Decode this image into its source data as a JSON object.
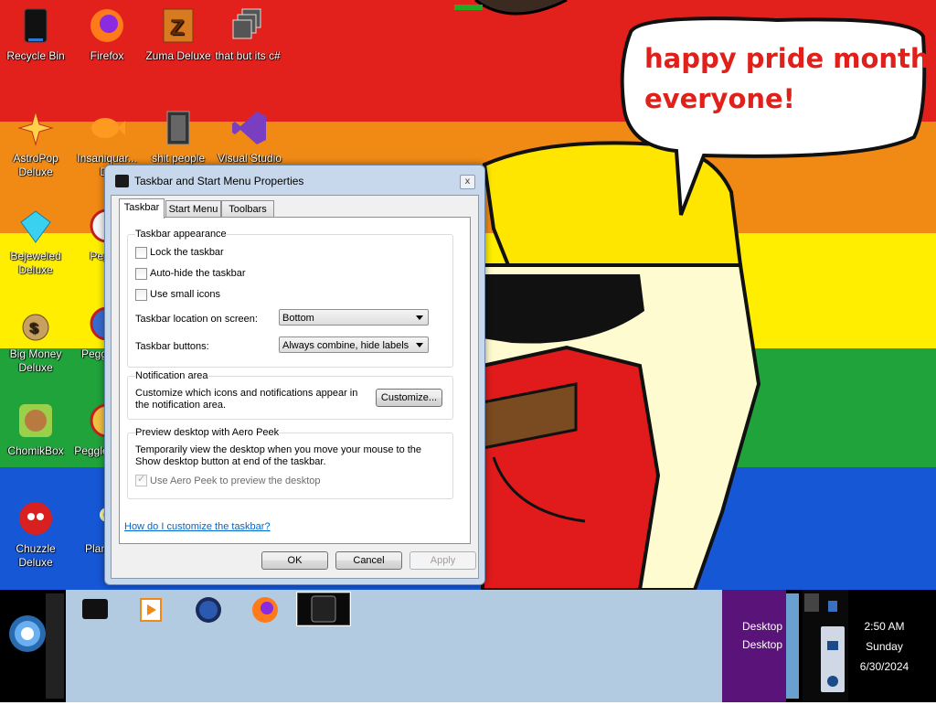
{
  "colors": {
    "stripes": [
      "#e3211c",
      "#f08a14",
      "#ffee00",
      "#1fa33a",
      "#1657d6"
    ],
    "bubble_text": "#e0201a",
    "taskbar_bg": "#b3cbe0",
    "tray_bg": "#5a1378"
  },
  "desktop": {
    "icons": [
      {
        "label": "Recycle Bin",
        "icon": "recycle-bin-icon"
      },
      {
        "label": "Firefox",
        "icon": "firefox-icon"
      },
      {
        "label": "Zuma Deluxe",
        "icon": "zuma-icon"
      },
      {
        "label": "that but its c#",
        "icon": "copy-icon"
      },
      {
        "label": "AstroPop Deluxe",
        "icon": "astropop-icon"
      },
      {
        "label": "Insaniquar... De",
        "icon": "fish-icon"
      },
      {
        "label": "shit people",
        "icon": "folder-icon"
      },
      {
        "label": "Visual Studio",
        "icon": "visual-studio-icon"
      },
      {
        "label": "Bejeweled Deluxe",
        "icon": "gem-icon"
      },
      {
        "label": "Peggle",
        "icon": "peggle-icon"
      },
      {
        "label": "Big Money Deluxe",
        "icon": "money-bag-icon"
      },
      {
        "label": "Peggle De",
        "icon": "peggle-icon"
      },
      {
        "label": "ChomikBox",
        "icon": "hamster-icon"
      },
      {
        "label": "Peggle of Wa",
        "icon": "peggle-icon"
      },
      {
        "label": "Chuzzle Deluxe",
        "icon": "chuzzle-icon"
      },
      {
        "label": "Plan Zon",
        "icon": "flower-icon"
      }
    ],
    "bubble_text_lines": [
      "happy pride month",
      "everyone!"
    ]
  },
  "dialog": {
    "title": "Taskbar and Start Menu Properties",
    "close": "x",
    "tabs": [
      "Taskbar",
      "Start Menu",
      "Toolbars"
    ],
    "appearance": {
      "title": "Taskbar appearance",
      "lock": "Lock the taskbar",
      "autohide": "Auto-hide the taskbar",
      "small_icons": "Use small icons",
      "location_label": "Taskbar location on screen:",
      "location_value": "Bottom",
      "buttons_label": "Taskbar buttons:",
      "buttons_value": "Always combine, hide labels"
    },
    "notification": {
      "title": "Notification area",
      "text": "Customize which icons and notifications appear in the notification area.",
      "button": "Customize..."
    },
    "peek": {
      "title": "Preview desktop with Aero Peek",
      "text": "Temporarily view the desktop when you move your mouse to the Show desktop button at end of the taskbar.",
      "checkbox": "Use Aero Peek to preview the desktop"
    },
    "help_link": "How do I customize the taskbar?",
    "ok": "OK",
    "cancel": "Cancel",
    "apply": "Apply"
  },
  "taskbar": {
    "tray_line1": "Desktop",
    "tray_line2": "Desktop",
    "time": "2:50 AM",
    "day": "Sunday",
    "date": "6/30/2024"
  }
}
